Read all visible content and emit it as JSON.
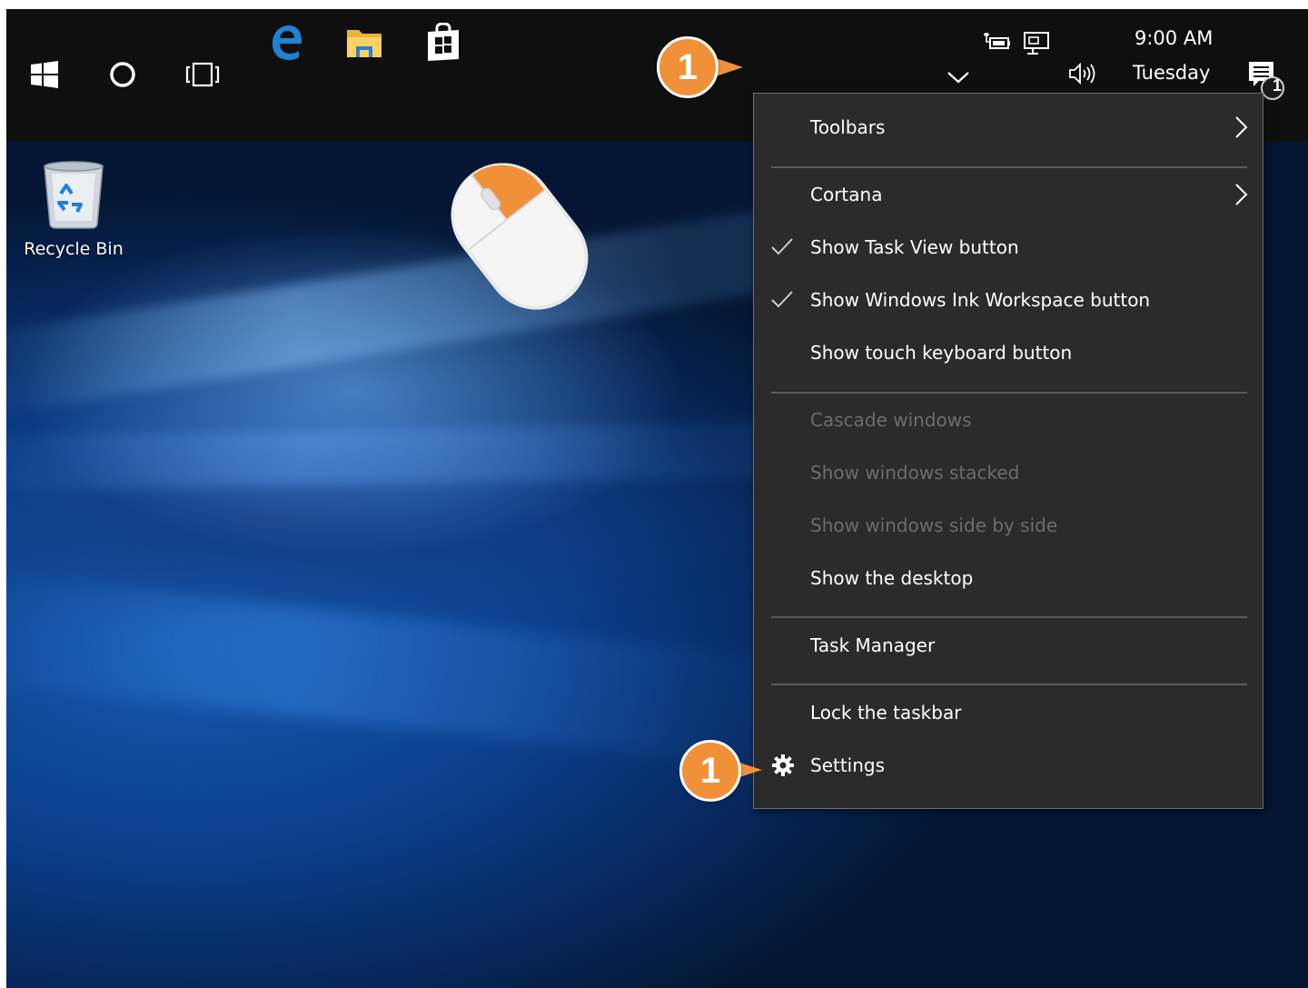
{
  "taskbar": {
    "start_icon": "windows-logo-icon",
    "cortana_icon": "cortana-circle-icon",
    "task_view_icon": "task-view-icon",
    "pinned": [
      {
        "name": "edge-icon",
        "color": "#1e82d6"
      },
      {
        "name": "file-explorer-icon",
        "color": "#f5c64a"
      },
      {
        "name": "store-icon",
        "color": "#ffffff"
      }
    ],
    "tray": {
      "chevron_icon": "chevron-up-icon",
      "power_icon": "power-icon",
      "network_icon": "network-icon",
      "volume_icon": "volume-icon",
      "time": "9:00 AM",
      "day": "Tuesday",
      "notification_icon": "action-center-icon",
      "notification_count": "1"
    }
  },
  "desktop": {
    "recycle_bin_label": "Recycle Bin"
  },
  "callouts": {
    "taskbar_step": "1",
    "settings_step": "1",
    "color": "#f0913a"
  },
  "menu": {
    "items": {
      "toolbars": "Toolbars",
      "cortana": "Cortana",
      "show_task_view": "Show Task View button",
      "show_ink_workspace": "Show Windows Ink Workspace button",
      "show_touch_keyboard": "Show touch keyboard button",
      "cascade": "Cascade windows",
      "stacked": "Show windows stacked",
      "side_by_side": "Show windows side by side",
      "show_desktop": "Show the desktop",
      "task_manager": "Task Manager",
      "lock_taskbar": "Lock the taskbar",
      "settings": "Settings"
    },
    "checked": [
      "Show Task View button",
      "Show Windows Ink Workspace button"
    ],
    "disabled": [
      "Cascade windows",
      "Show windows stacked",
      "Show windows side by side"
    ]
  }
}
